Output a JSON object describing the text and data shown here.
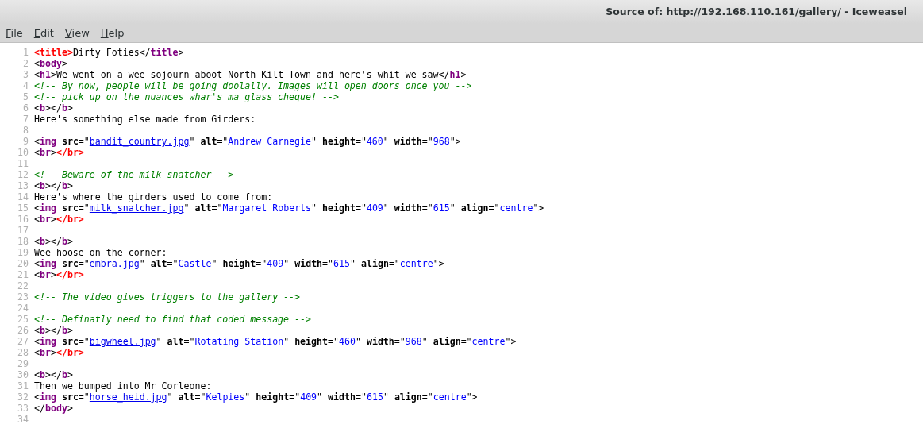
{
  "window": {
    "title": "Source of: http://192.168.110.161/gallery/ - Iceweasel"
  },
  "menu": [
    {
      "label": "File"
    },
    {
      "label": "Edit"
    },
    {
      "label": "View"
    },
    {
      "label": "Help"
    }
  ],
  "source_lines": [
    {
      "number": "1",
      "segments": [
        {
          "kind": "error",
          "text": "<title>"
        },
        {
          "kind": "text",
          "text": "Dirty Foties</"
        },
        {
          "kind": "tag",
          "text": "title"
        },
        {
          "kind": "text",
          "text": ">"
        }
      ]
    },
    {
      "number": "2",
      "segments": [
        {
          "kind": "text",
          "text": "<"
        },
        {
          "kind": "tag",
          "text": "body"
        },
        {
          "kind": "text",
          "text": ">"
        }
      ]
    },
    {
      "number": "3",
      "segments": [
        {
          "kind": "text",
          "text": "<"
        },
        {
          "kind": "tag",
          "text": "h1"
        },
        {
          "kind": "text",
          "text": ">We went on a wee sojourn aboot North Kilt Town and here's whit we saw</"
        },
        {
          "kind": "tag",
          "text": "h1"
        },
        {
          "kind": "text",
          "text": ">"
        }
      ]
    },
    {
      "number": "4",
      "segments": [
        {
          "kind": "comment",
          "text": "<!-- By now, people will be going doolally. Images will open doors once you -->"
        }
      ]
    },
    {
      "number": "5",
      "segments": [
        {
          "kind": "comment",
          "text": "<!-- pick up on the nuances whar's ma glass cheque! -->"
        }
      ]
    },
    {
      "number": "6",
      "segments": [
        {
          "kind": "text",
          "text": "<"
        },
        {
          "kind": "tag",
          "text": "b"
        },
        {
          "kind": "text",
          "text": "></"
        },
        {
          "kind": "tag",
          "text": "b"
        },
        {
          "kind": "text",
          "text": ">"
        }
      ]
    },
    {
      "number": "7",
      "segments": [
        {
          "kind": "text",
          "text": "Here's something else made from Girders:"
        }
      ]
    },
    {
      "number": "8"
    },
    {
      "number": "9",
      "segments": [
        {
          "kind": "text",
          "text": "<"
        },
        {
          "kind": "tag",
          "text": "img"
        },
        {
          "kind": "attr",
          "text": " src"
        },
        {
          "kind": "text",
          "text": "=\""
        },
        {
          "kind": "link",
          "text": "bandit_country.jpg"
        },
        {
          "kind": "text",
          "text": "\" "
        },
        {
          "kind": "attr",
          "text": "alt"
        },
        {
          "kind": "text",
          "text": "=\""
        },
        {
          "kind": "value",
          "text": "Andrew Carnegie"
        },
        {
          "kind": "text",
          "text": "\" "
        },
        {
          "kind": "attr",
          "text": "height"
        },
        {
          "kind": "text",
          "text": "=\""
        },
        {
          "kind": "value",
          "text": "460"
        },
        {
          "kind": "text",
          "text": "\" "
        },
        {
          "kind": "attr",
          "text": "width"
        },
        {
          "kind": "text",
          "text": "=\""
        },
        {
          "kind": "value",
          "text": "968"
        },
        {
          "kind": "text",
          "text": "\">"
        }
      ]
    },
    {
      "number": "10",
      "segments": [
        {
          "kind": "text",
          "text": "<"
        },
        {
          "kind": "tag",
          "text": "br"
        },
        {
          "kind": "text",
          "text": ">"
        },
        {
          "kind": "error",
          "text": "</br>"
        }
      ]
    },
    {
      "number": "11"
    },
    {
      "number": "12",
      "segments": [
        {
          "kind": "comment",
          "text": "<!-- Beware of the milk snatcher -->"
        }
      ]
    },
    {
      "number": "13",
      "segments": [
        {
          "kind": "text",
          "text": "<"
        },
        {
          "kind": "tag",
          "text": "b"
        },
        {
          "kind": "text",
          "text": "></"
        },
        {
          "kind": "tag",
          "text": "b"
        },
        {
          "kind": "text",
          "text": ">"
        }
      ]
    },
    {
      "number": "14",
      "segments": [
        {
          "kind": "text",
          "text": "Here's where the girders used to come from:"
        }
      ]
    },
    {
      "number": "15",
      "segments": [
        {
          "kind": "text",
          "text": "<"
        },
        {
          "kind": "tag",
          "text": "img"
        },
        {
          "kind": "attr",
          "text": " src"
        },
        {
          "kind": "text",
          "text": "=\""
        },
        {
          "kind": "link",
          "text": "milk_snatcher.jpg"
        },
        {
          "kind": "text",
          "text": "\" "
        },
        {
          "kind": "attr",
          "text": "alt"
        },
        {
          "kind": "text",
          "text": "=\""
        },
        {
          "kind": "value",
          "text": "Margaret Roberts"
        },
        {
          "kind": "text",
          "text": "\" "
        },
        {
          "kind": "attr",
          "text": "height"
        },
        {
          "kind": "text",
          "text": "=\""
        },
        {
          "kind": "value",
          "text": "409"
        },
        {
          "kind": "text",
          "text": "\" "
        },
        {
          "kind": "attr",
          "text": "width"
        },
        {
          "kind": "text",
          "text": "=\""
        },
        {
          "kind": "value",
          "text": "615"
        },
        {
          "kind": "text",
          "text": "\" "
        },
        {
          "kind": "attr",
          "text": "align"
        },
        {
          "kind": "text",
          "text": "=\""
        },
        {
          "kind": "value",
          "text": "centre"
        },
        {
          "kind": "text",
          "text": "\">"
        }
      ]
    },
    {
      "number": "16",
      "segments": [
        {
          "kind": "text",
          "text": "<"
        },
        {
          "kind": "tag",
          "text": "br"
        },
        {
          "kind": "text",
          "text": ">"
        },
        {
          "kind": "error",
          "text": "</br>"
        }
      ]
    },
    {
      "number": "17"
    },
    {
      "number": "18",
      "segments": [
        {
          "kind": "text",
          "text": "<"
        },
        {
          "kind": "tag",
          "text": "b"
        },
        {
          "kind": "text",
          "text": "></"
        },
        {
          "kind": "tag",
          "text": "b"
        },
        {
          "kind": "text",
          "text": ">"
        }
      ]
    },
    {
      "number": "19",
      "segments": [
        {
          "kind": "text",
          "text": "Wee hoose on the corner:"
        }
      ]
    },
    {
      "number": "20",
      "segments": [
        {
          "kind": "text",
          "text": "<"
        },
        {
          "kind": "tag",
          "text": "img"
        },
        {
          "kind": "attr",
          "text": " src"
        },
        {
          "kind": "text",
          "text": "=\""
        },
        {
          "kind": "link",
          "text": "embra.jpg"
        },
        {
          "kind": "text",
          "text": "\" "
        },
        {
          "kind": "attr",
          "text": "alt"
        },
        {
          "kind": "text",
          "text": "=\""
        },
        {
          "kind": "value",
          "text": "Castle"
        },
        {
          "kind": "text",
          "text": "\" "
        },
        {
          "kind": "attr",
          "text": "height"
        },
        {
          "kind": "text",
          "text": "=\""
        },
        {
          "kind": "value",
          "text": "409"
        },
        {
          "kind": "text",
          "text": "\" "
        },
        {
          "kind": "attr",
          "text": "width"
        },
        {
          "kind": "text",
          "text": "=\""
        },
        {
          "kind": "value",
          "text": "615"
        },
        {
          "kind": "text",
          "text": "\" "
        },
        {
          "kind": "attr",
          "text": "align"
        },
        {
          "kind": "text",
          "text": "=\""
        },
        {
          "kind": "value",
          "text": "centre"
        },
        {
          "kind": "text",
          "text": "\">"
        }
      ]
    },
    {
      "number": "21",
      "segments": [
        {
          "kind": "text",
          "text": "<"
        },
        {
          "kind": "tag",
          "text": "br"
        },
        {
          "kind": "text",
          "text": ">"
        },
        {
          "kind": "error",
          "text": "</br>"
        }
      ]
    },
    {
      "number": "22"
    },
    {
      "number": "23",
      "segments": [
        {
          "kind": "comment",
          "text": "<!-- The video gives triggers to the gallery -->"
        }
      ]
    },
    {
      "number": "24"
    },
    {
      "number": "25",
      "segments": [
        {
          "kind": "comment",
          "text": "<!-- Definatly need to find that coded message -->"
        }
      ]
    },
    {
      "number": "26",
      "segments": [
        {
          "kind": "text",
          "text": "<"
        },
        {
          "kind": "tag",
          "text": "b"
        },
        {
          "kind": "text",
          "text": "></"
        },
        {
          "kind": "tag",
          "text": "b"
        },
        {
          "kind": "text",
          "text": ">"
        }
      ]
    },
    {
      "number": "27",
      "segments": [
        {
          "kind": "text",
          "text": "<"
        },
        {
          "kind": "tag",
          "text": "img"
        },
        {
          "kind": "attr",
          "text": " src"
        },
        {
          "kind": "text",
          "text": "=\""
        },
        {
          "kind": "link",
          "text": "bigwheel.jpg"
        },
        {
          "kind": "text",
          "text": "\" "
        },
        {
          "kind": "attr",
          "text": "alt"
        },
        {
          "kind": "text",
          "text": "=\""
        },
        {
          "kind": "value",
          "text": "Rotating Station"
        },
        {
          "kind": "text",
          "text": "\" "
        },
        {
          "kind": "attr",
          "text": "height"
        },
        {
          "kind": "text",
          "text": "=\""
        },
        {
          "kind": "value",
          "text": "460"
        },
        {
          "kind": "text",
          "text": "\" "
        },
        {
          "kind": "attr",
          "text": "width"
        },
        {
          "kind": "text",
          "text": "=\""
        },
        {
          "kind": "value",
          "text": "968"
        },
        {
          "kind": "text",
          "text": "\" "
        },
        {
          "kind": "attr",
          "text": "align"
        },
        {
          "kind": "text",
          "text": "=\""
        },
        {
          "kind": "value",
          "text": "centre"
        },
        {
          "kind": "text",
          "text": "\">"
        }
      ]
    },
    {
      "number": "28",
      "segments": [
        {
          "kind": "text",
          "text": "<"
        },
        {
          "kind": "tag",
          "text": "br"
        },
        {
          "kind": "text",
          "text": ">"
        },
        {
          "kind": "error",
          "text": "</br>"
        }
      ]
    },
    {
      "number": "29"
    },
    {
      "number": "30",
      "segments": [
        {
          "kind": "text",
          "text": "<"
        },
        {
          "kind": "tag",
          "text": "b"
        },
        {
          "kind": "text",
          "text": "></"
        },
        {
          "kind": "tag",
          "text": "b"
        },
        {
          "kind": "text",
          "text": ">"
        }
      ]
    },
    {
      "number": "31",
      "segments": [
        {
          "kind": "text",
          "text": "Then we bumped into Mr Corleone:"
        }
      ]
    },
    {
      "number": "32",
      "segments": [
        {
          "kind": "text",
          "text": "<"
        },
        {
          "kind": "tag",
          "text": "img"
        },
        {
          "kind": "attr",
          "text": " src"
        },
        {
          "kind": "text",
          "text": "=\""
        },
        {
          "kind": "link",
          "text": "horse_heid.jpg"
        },
        {
          "kind": "text",
          "text": "\" "
        },
        {
          "kind": "attr",
          "text": "alt"
        },
        {
          "kind": "text",
          "text": "=\""
        },
        {
          "kind": "value",
          "text": "Kelpies"
        },
        {
          "kind": "text",
          "text": "\" "
        },
        {
          "kind": "attr",
          "text": "height"
        },
        {
          "kind": "text",
          "text": "=\""
        },
        {
          "kind": "value",
          "text": "409"
        },
        {
          "kind": "text",
          "text": "\" "
        },
        {
          "kind": "attr",
          "text": "width"
        },
        {
          "kind": "text",
          "text": "=\""
        },
        {
          "kind": "value",
          "text": "615"
        },
        {
          "kind": "text",
          "text": "\" "
        },
        {
          "kind": "attr",
          "text": "align"
        },
        {
          "kind": "text",
          "text": "=\""
        },
        {
          "kind": "value",
          "text": "centre"
        },
        {
          "kind": "text",
          "text": "\">"
        }
      ]
    },
    {
      "number": "33",
      "segments": [
        {
          "kind": "text",
          "text": "</"
        },
        {
          "kind": "tag",
          "text": "body"
        },
        {
          "kind": "text",
          "text": ">"
        }
      ]
    },
    {
      "number": "34"
    }
  ]
}
